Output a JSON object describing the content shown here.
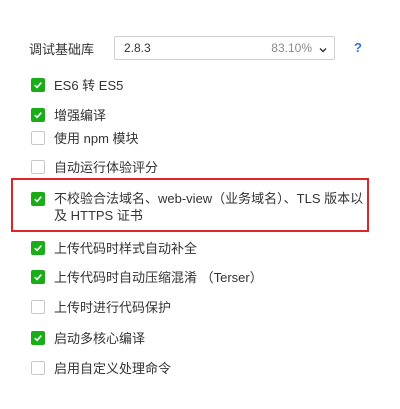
{
  "base_lib": {
    "label": "调试基础库",
    "version": "2.8.3",
    "percent": "83.10%",
    "help": "?"
  },
  "options": [
    {
      "label": "ES6 转 ES5",
      "checked": true
    },
    {
      "label": "增强编译",
      "checked": true
    },
    {
      "label": "使用 npm 模块",
      "checked": false
    },
    {
      "label": "自动运行体验评分",
      "checked": false
    },
    {
      "label": "不校验合法域名、web-view（业务域名）、TLS 版本以及 HTTPS 证书",
      "checked": true
    },
    {
      "label": "上传代码时样式自动补全",
      "checked": true
    },
    {
      "label": "上传代码时自动压缩混淆 （Terser）",
      "checked": true
    },
    {
      "label": "上传时进行代码保护",
      "checked": false
    },
    {
      "label": "启动多核心编译",
      "checked": true
    },
    {
      "label": "启用自定义处理命令",
      "checked": false
    }
  ],
  "colors": {
    "checkbox_checked": "#1aad19",
    "highlight": "#e02424",
    "help": "#2d73d8"
  }
}
